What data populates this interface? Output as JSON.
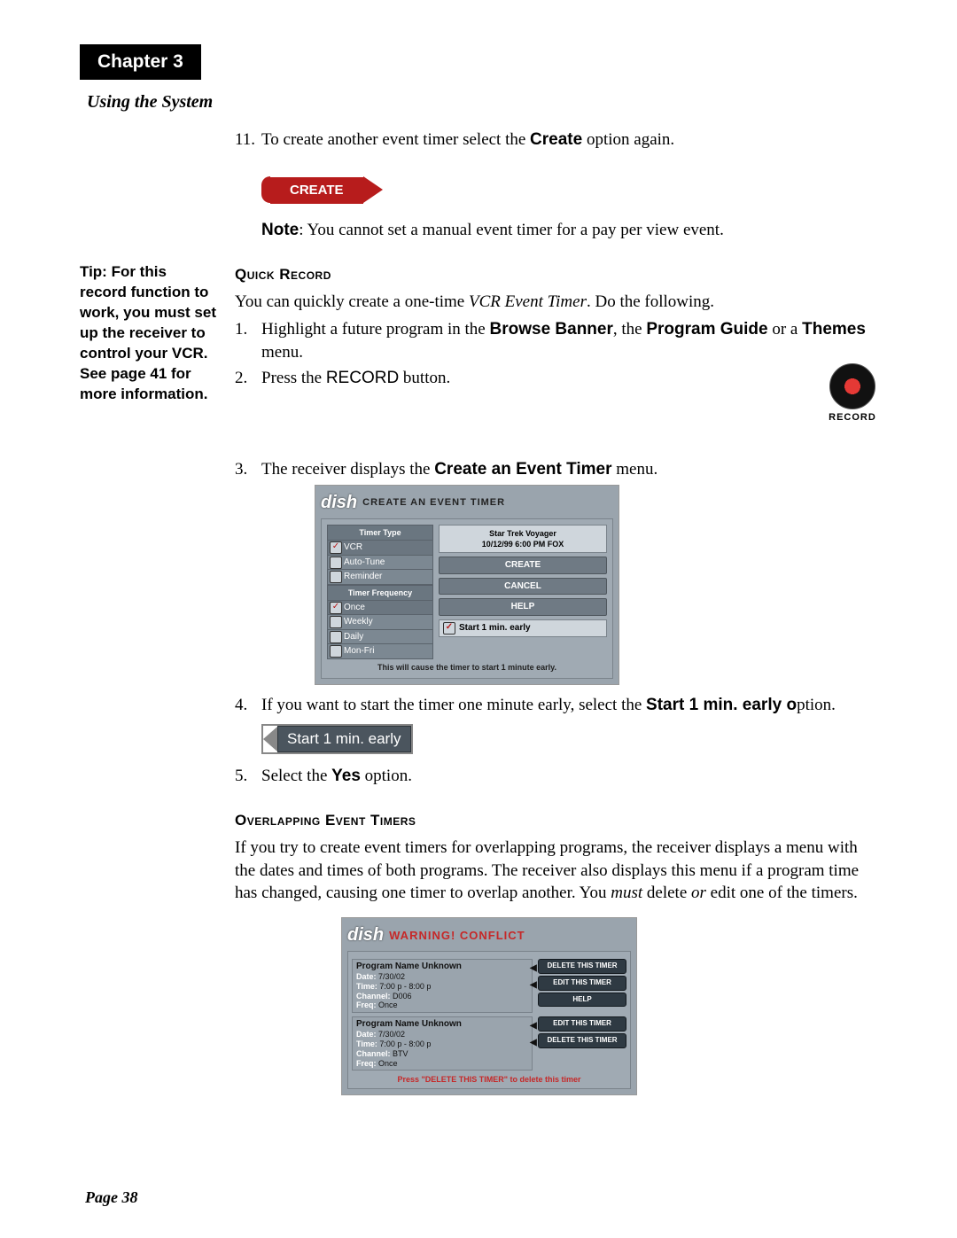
{
  "header": {
    "chapter": "Chapter 3",
    "subtitle": "Using the System"
  },
  "sidebar": {
    "tip": "Tip: For this record function to work, you must set up the receiver to control your VCR. See page 41 for more information."
  },
  "step11": {
    "num": "11.",
    "text_a": "To create another event timer select the ",
    "bold": "Create",
    "text_b": " option again."
  },
  "create_button": "CREATE",
  "note": {
    "label": "Note",
    "text": ": You cannot set a manual event timer for a pay per view event."
  },
  "quick_record": {
    "heading": "Quick Record",
    "intro_a": "You can quickly create a one-time ",
    "intro_italic": "VCR Event Timer",
    "intro_b": ". Do the following.",
    "s1": {
      "num": "1.",
      "a": "Highlight a future program in the ",
      "b1": "Browse Banner",
      "m": ", the ",
      "b2": "Program Guide",
      "m2": " or a ",
      "b3": "Themes",
      "e": " menu."
    },
    "s2": {
      "num": "2.",
      "a": "Press the ",
      "btn": "RECORD",
      "b": " button."
    },
    "s3": {
      "num": "3.",
      "a": "The receiver displays the ",
      "b": "Create an Event Timer",
      "c": " menu."
    },
    "s4": {
      "num": "4.",
      "a": "If you want to start the timer one minute early, select the ",
      "b": "Start 1 min. early o",
      "c": "ption."
    },
    "s5": {
      "num": "5.",
      "a": "Select the ",
      "b": "Yes",
      "c": " option."
    }
  },
  "record_icon_label": "RECORD",
  "screenshot1": {
    "logo": "dish",
    "title": "CREATE AN EVENT TIMER",
    "group1": "Timer Type",
    "items1": [
      "VCR",
      "Auto-Tune",
      "Reminder"
    ],
    "group2": "Timer Frequency",
    "items2": [
      "Once",
      "Weekly",
      "Daily",
      "Mon-Fri"
    ],
    "info1": "Star Trek Voyager",
    "info2": "10/12/99 6:00 PM FOX",
    "btn_create": "CREATE",
    "btn_cancel": "CANCEL",
    "btn_help": "HELP",
    "start_early": "Start 1 min. early",
    "footer": "This will cause the timer to start 1 minute early."
  },
  "start_early_pill": "Start 1 min. early",
  "overlap": {
    "heading": "Overlapping Event Timers",
    "p_a": "If you try to create event timers for overlapping programs, the receiver displays a menu with the dates and times of both programs. The receiver also displays this menu if a program time has changed, causing one timer to overlap another. You ",
    "p_i1": "must",
    "p_m": " delete ",
    "p_i2": "or",
    "p_b": " edit one of the timers."
  },
  "screenshot2": {
    "logo": "dish",
    "title": "WARNING! CONFLICT",
    "rows": [
      {
        "name": "Program Name Unknown",
        "date": "7/30/02",
        "time": "7:00 p - 8:00 p",
        "channel": "D006",
        "freq": "Once"
      },
      {
        "name": "Program Name Unknown",
        "date": "7/30/02",
        "time": "7:00 p - 8:00 p",
        "channel": "BTV",
        "freq": "Once"
      }
    ],
    "labels": {
      "date": "Date:",
      "time": "Time:",
      "channel": "Channel:",
      "freq": "Freq:"
    },
    "btns_top": [
      "DELETE THIS TIMER",
      "EDIT THIS TIMER",
      "HELP"
    ],
    "btns_bot": [
      "EDIT THIS TIMER",
      "DELETE THIS TIMER"
    ],
    "footer": "Press \"DELETE THIS TIMER\" to delete this timer"
  },
  "page_number": "Page 38"
}
